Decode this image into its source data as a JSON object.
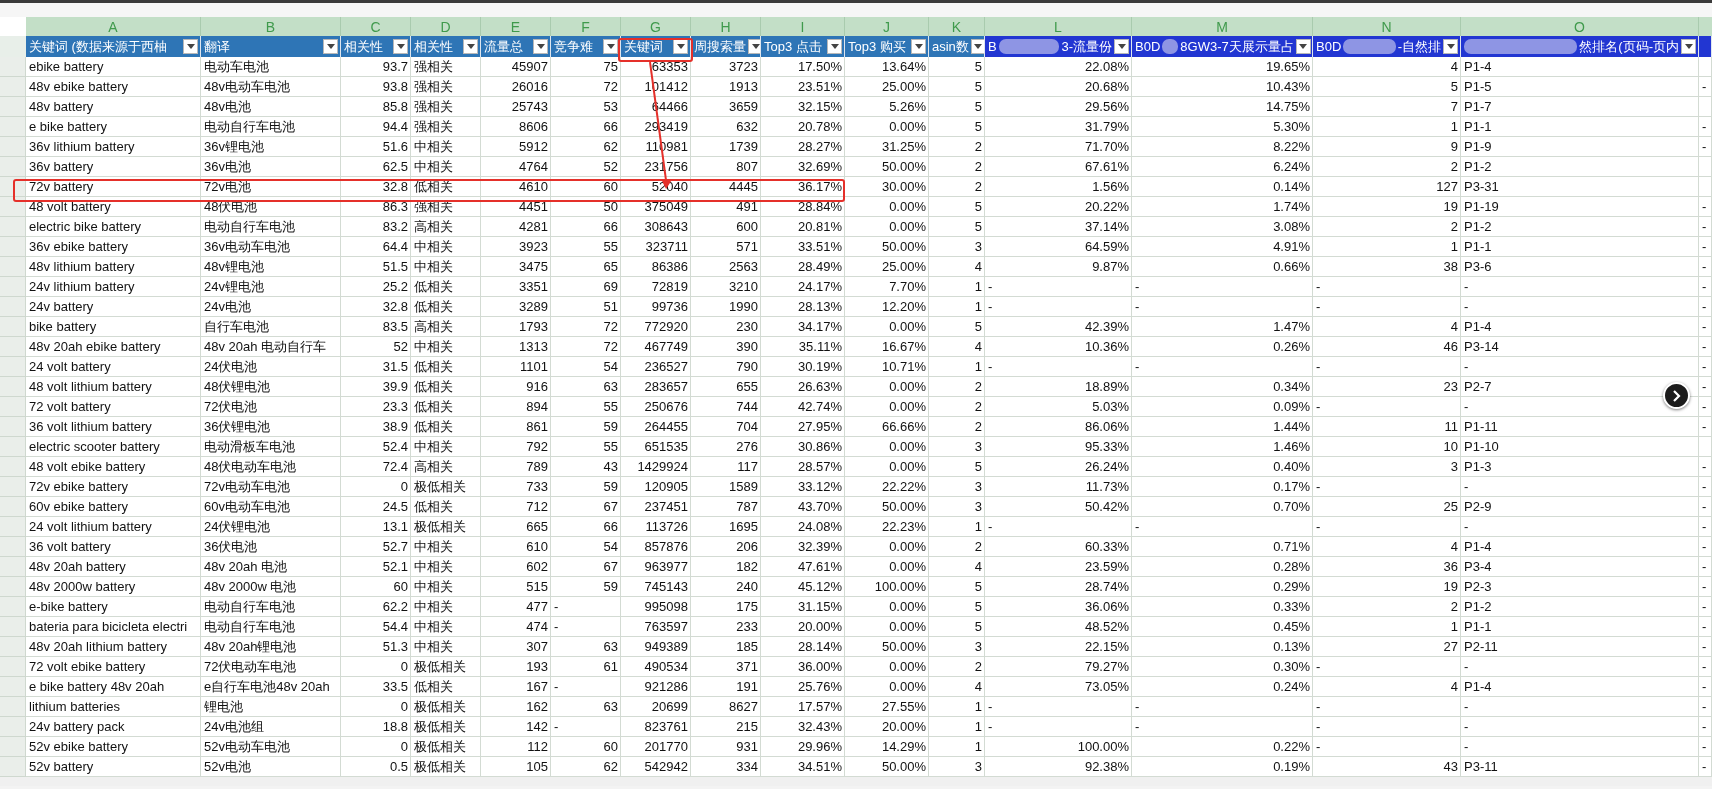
{
  "column_letters": [
    "A",
    "B",
    "C",
    "D",
    "E",
    "F",
    "G",
    "H",
    "I",
    "J",
    "K",
    "L",
    "M",
    "N",
    "O"
  ],
  "headers": [
    {
      "parts": [
        {
          "kind": "text",
          "text": "关键词 (数据来源于西柚"
        }
      ],
      "color": "#2e75b6",
      "filter": true
    },
    {
      "parts": [
        {
          "kind": "text",
          "text": "翻译"
        }
      ],
      "color": "#2e75b6",
      "filter": true
    },
    {
      "parts": [
        {
          "kind": "text",
          "text": "相关性"
        }
      ],
      "color": "#2e75b6",
      "filter": true
    },
    {
      "parts": [
        {
          "kind": "text",
          "text": "相关性"
        }
      ],
      "color": "#2e75b6",
      "filter": true
    },
    {
      "parts": [
        {
          "kind": "text",
          "text": "流量总"
        }
      ],
      "color": "#2e75b6",
      "filter": true
    },
    {
      "parts": [
        {
          "kind": "text",
          "text": "竞争难"
        }
      ],
      "color": "#2e75b6",
      "filter": true
    },
    {
      "parts": [
        {
          "kind": "text",
          "text": "关键词"
        }
      ],
      "color": "#2e75b6",
      "filter": true
    },
    {
      "parts": [
        {
          "kind": "text",
          "text": "周搜索量"
        }
      ],
      "color": "#2e75b6",
      "filter": true
    },
    {
      "parts": [
        {
          "kind": "text",
          "text": "Top3 点击"
        }
      ],
      "color": "#2e75b6",
      "filter": true
    },
    {
      "parts": [
        {
          "kind": "text",
          "text": "Top3 购买"
        }
      ],
      "color": "#2e75b6",
      "filter": true
    },
    {
      "parts": [
        {
          "kind": "text",
          "text": "asin数"
        }
      ],
      "color": "#2e75b6",
      "filter": true
    },
    {
      "parts": [
        {
          "kind": "text",
          "text": "B"
        },
        {
          "kind": "redacted"
        },
        {
          "kind": "text",
          "text": "3-流量份"
        }
      ],
      "color": "#2236d2",
      "filter": true
    },
    {
      "parts": [
        {
          "kind": "text",
          "text": "B0D"
        },
        {
          "kind": "redacted"
        },
        {
          "kind": "text",
          "text": "8GW3-7天展示量占"
        }
      ],
      "color": "#2236d2",
      "filter": true
    },
    {
      "parts": [
        {
          "kind": "text",
          "text": "B0D"
        },
        {
          "kind": "redacted"
        },
        {
          "kind": "text",
          "text": "-自然排"
        }
      ],
      "color": "#2236d2",
      "filter": true
    },
    {
      "parts": [
        {
          "kind": "redacted"
        },
        {
          "kind": "text",
          "text": "然排名(页码-页内"
        }
      ],
      "color": "#2236d2",
      "filter": true
    },
    {
      "color": "#2236d2"
    }
  ],
  "rows": [
    [
      "ebike battery",
      "电动车电池",
      "93.7",
      "强相关",
      "45907",
      "75",
      "63353",
      "3723",
      "17.50%",
      "13.64%",
      "5",
      "22.08%",
      "19.65%",
      "4",
      "P1-4",
      null
    ],
    [
      "48v ebike battery",
      "48v电动车电池",
      "93.8",
      "强相关",
      "26016",
      "72",
      "101412",
      "1913",
      "23.51%",
      "25.00%",
      "5",
      "20.68%",
      "10.43%",
      "5",
      "P1-5",
      {
        "kind": "blank",
        "text": "-"
      }
    ],
    [
      "48v battery",
      "48v电池",
      "85.8",
      "强相关",
      "25743",
      "53",
      "64466",
      "3659",
      "32.15%",
      "5.26%",
      "5",
      "29.56%",
      "14.75%",
      "7",
      "P1-7",
      null
    ],
    [
      "e bike battery",
      "电动自行车电池",
      "94.4",
      "强相关",
      "8606",
      "66",
      "293419",
      "632",
      "20.78%",
      "0.00%",
      "5",
      "31.79%",
      "5.30%",
      "1",
      "P1-1",
      {
        "kind": "blank",
        "text": "-"
      }
    ],
    [
      "36v lithium battery",
      "36v锂电池",
      "51.6",
      "中相关",
      "5912",
      "62",
      "110981",
      "1739",
      "28.27%",
      "31.25%",
      "2",
      "71.70%",
      "8.22%",
      "9",
      "P1-9",
      {
        "kind": "blank",
        "text": "-"
      }
    ],
    [
      "36v battery",
      "36v电池",
      "62.5",
      "中相关",
      "4764",
      "52",
      "231756",
      "807",
      "32.69%",
      "50.00%",
      "2",
      "67.61%",
      "6.24%",
      "2",
      "P1-2",
      null
    ],
    [
      "72v battery",
      "72v电池",
      "32.8",
      "低相关",
      "4610",
      "60",
      "52040",
      "4445",
      "36.17%",
      "30.00%",
      "2",
      "1.56%",
      "0.14%",
      "127",
      "P3-31",
      null
    ],
    [
      "48 volt battery",
      "48伏电池",
      "86.3",
      "强相关",
      "4451",
      "50",
      "375049",
      "491",
      "28.84%",
      "0.00%",
      "5",
      "20.22%",
      "1.74%",
      "19",
      "P1-19",
      {
        "kind": "blank",
        "text": "-"
      }
    ],
    [
      "electric bike battery",
      "电动自行车电池",
      "83.2",
      "高相关",
      "4281",
      "66",
      "308643",
      "600",
      "20.81%",
      "0.00%",
      "5",
      "37.14%",
      "3.08%",
      "2",
      "P1-2",
      {
        "kind": "blank",
        "text": "-"
      }
    ],
    [
      "36v ebike battery",
      "36v电动车电池",
      "64.4",
      "中相关",
      "3923",
      "55",
      "323711",
      "571",
      "33.51%",
      "50.00%",
      "3",
      "64.59%",
      "4.91%",
      "1",
      "P1-1",
      {
        "kind": "blank",
        "text": "-"
      }
    ],
    [
      "48v lithium battery",
      "48v锂电池",
      "51.5",
      "中相关",
      "3475",
      "65",
      "86386",
      "2563",
      "28.49%",
      "25.00%",
      "4",
      "9.87%",
      "0.66%",
      "38",
      "P3-6",
      {
        "kind": "blank",
        "text": "-"
      }
    ],
    [
      "24v lithium battery",
      "24v锂电池",
      "25.2",
      "低相关",
      "3351",
      "69",
      "72819",
      "3210",
      "24.17%",
      "7.70%",
      "1",
      {
        "kind": "blank",
        "text": "-"
      },
      {
        "kind": "blank",
        "text": "-"
      },
      {
        "kind": "blank",
        "text": "-"
      },
      {
        "kind": "blank",
        "text": "-"
      },
      {
        "kind": "blank",
        "text": "-"
      }
    ],
    [
      "24v battery",
      "24v电池",
      "32.8",
      "低相关",
      "3289",
      "51",
      "99736",
      "1990",
      "28.13%",
      "12.20%",
      "1",
      {
        "kind": "blank",
        "text": "-"
      },
      {
        "kind": "blank",
        "text": "-"
      },
      {
        "kind": "blank",
        "text": "-"
      },
      {
        "kind": "blank",
        "text": "-"
      },
      {
        "kind": "blank",
        "text": "-"
      }
    ],
    [
      "bike battery",
      "自行车电池",
      "83.5",
      "高相关",
      "1793",
      "72",
      "772920",
      "230",
      "34.17%",
      "0.00%",
      "5",
      "42.39%",
      "1.47%",
      "4",
      "P1-4",
      {
        "kind": "blank",
        "text": "-"
      }
    ],
    [
      "48v 20ah ebike battery",
      "48v 20ah 电动自行车",
      "52",
      "中相关",
      "1313",
      "72",
      "467749",
      "390",
      "35.11%",
      "16.67%",
      "4",
      "10.36%",
      "0.26%",
      "46",
      "P3-14",
      {
        "kind": "blank",
        "text": "-"
      }
    ],
    [
      "24 volt battery",
      "24伏电池",
      "31.5",
      "低相关",
      "1101",
      "54",
      "236527",
      "790",
      "30.19%",
      "10.71%",
      "1",
      {
        "kind": "blank",
        "text": "-"
      },
      {
        "kind": "blank",
        "text": "-"
      },
      {
        "kind": "blank",
        "text": "-"
      },
      {
        "kind": "blank",
        "text": "-"
      },
      {
        "kind": "blank",
        "text": "-"
      }
    ],
    [
      "48 volt lithium battery",
      "48伏锂电池",
      "39.9",
      "低相关",
      "916",
      "63",
      "283657",
      "655",
      "26.63%",
      "0.00%",
      "2",
      "18.89%",
      "0.34%",
      "23",
      "P2-7",
      {
        "kind": "blank",
        "text": "-"
      }
    ],
    [
      "72 volt battery",
      "72伏电池",
      "23.3",
      "低相关",
      "894",
      "55",
      "250676",
      "744",
      "42.74%",
      "0.00%",
      "2",
      "5.03%",
      "0.09%",
      {
        "kind": "blank",
        "text": "-"
      },
      {
        "kind": "blank",
        "text": "-"
      },
      {
        "kind": "blank",
        "text": "-"
      }
    ],
    [
      "36 volt lithium battery",
      "36伏锂电池",
      "38.9",
      "低相关",
      "861",
      "59",
      "264455",
      "704",
      "27.95%",
      "66.66%",
      "2",
      "86.06%",
      "1.44%",
      "11",
      "P1-11",
      {
        "kind": "blank",
        "text": "-"
      }
    ],
    [
      "electric scooter battery",
      "电动滑板车电池",
      "52.4",
      "中相关",
      "792",
      "55",
      "651535",
      "276",
      "30.86%",
      "0.00%",
      "3",
      "95.33%",
      "1.46%",
      "10",
      "P1-10",
      null
    ],
    [
      "48 volt ebike battery",
      "48伏电动车电池",
      "72.4",
      "高相关",
      "789",
      "43",
      "1429924",
      "117",
      "28.57%",
      "0.00%",
      "5",
      "26.24%",
      "0.40%",
      "3",
      "P1-3",
      {
        "kind": "blank",
        "text": "-"
      }
    ],
    [
      "72v ebike battery",
      "72v电动车电池",
      "0",
      "极低相关",
      "733",
      "59",
      "120905",
      "1589",
      "33.12%",
      "22.22%",
      "3",
      "11.73%",
      "0.17%",
      {
        "kind": "blank",
        "text": "-"
      },
      {
        "kind": "blank",
        "text": "-"
      },
      {
        "kind": "blank",
        "text": "-"
      }
    ],
    [
      "60v ebike battery",
      "60v电动车电池",
      "24.5",
      "低相关",
      "712",
      "67",
      "237451",
      "787",
      "43.70%",
      "50.00%",
      "3",
      "50.42%",
      "0.70%",
      "25",
      "P2-9",
      {
        "kind": "blank",
        "text": "-"
      }
    ],
    [
      "24 volt lithium battery",
      "24伏锂电池",
      "13.1",
      "极低相关",
      "665",
      "66",
      "113726",
      "1695",
      "24.08%",
      "22.23%",
      "1",
      {
        "kind": "blank",
        "text": "-"
      },
      {
        "kind": "blank",
        "text": "-"
      },
      {
        "kind": "blank",
        "text": "-"
      },
      {
        "kind": "blank",
        "text": "-"
      },
      {
        "kind": "blank",
        "text": "-"
      }
    ],
    [
      "36 volt battery",
      "36伏电池",
      "52.7",
      "中相关",
      "610",
      "54",
      "857876",
      "206",
      "32.39%",
      "0.00%",
      "2",
      "60.33%",
      "0.71%",
      "4",
      "P1-4",
      {
        "kind": "blank",
        "text": "-"
      }
    ],
    [
      "48v 20ah battery",
      "48v 20ah 电池",
      "52.1",
      "中相关",
      "602",
      "67",
      "963977",
      "182",
      "47.61%",
      "0.00%",
      "4",
      "23.59%",
      "0.28%",
      "36",
      "P3-4",
      {
        "kind": "blank",
        "text": "-"
      }
    ],
    [
      "48v 2000w battery",
      "48v 2000w 电池",
      "60",
      "中相关",
      "515",
      "59",
      "745143",
      "240",
      "45.12%",
      "100.00%",
      "5",
      "28.74%",
      "0.29%",
      "19",
      "P2-3",
      {
        "kind": "blank",
        "text": "-"
      }
    ],
    [
      "e-bike battery",
      "电动自行车电池",
      "62.2",
      "中相关",
      "477",
      {
        "kind": "blank",
        "text": "-"
      },
      "995098",
      "175",
      "31.15%",
      "0.00%",
      "5",
      "36.06%",
      "0.33%",
      "2",
      "P1-2",
      {
        "kind": "blank",
        "text": "-"
      }
    ],
    [
      "bateria para bicicleta electri",
      "电动自行车电池",
      "54.4",
      "中相关",
      "474",
      {
        "kind": "blank",
        "text": "-"
      },
      "763597",
      "233",
      "20.00%",
      "0.00%",
      "5",
      "48.52%",
      "0.45%",
      "1",
      "P1-1",
      {
        "kind": "blank",
        "text": "-"
      }
    ],
    [
      "48v 20ah lithium battery",
      "48v 20ah锂电池",
      "51.3",
      "中相关",
      "307",
      "63",
      "949389",
      "185",
      "28.14%",
      "50.00%",
      "3",
      "22.15%",
      "0.13%",
      "27",
      "P2-11",
      {
        "kind": "blank",
        "text": "-"
      }
    ],
    [
      "72 volt ebike battery",
      "72伏电动车电池",
      "0",
      "极低相关",
      "193",
      "61",
      "490534",
      "371",
      "36.00%",
      "0.00%",
      "2",
      "79.27%",
      "0.30%",
      {
        "kind": "blank",
        "text": "-"
      },
      {
        "kind": "blank",
        "text": "-"
      },
      {
        "kind": "blank",
        "text": "-"
      }
    ],
    [
      "e bike battery 48v 20ah",
      "e自行车电池48v 20ah",
      "33.5",
      "低相关",
      "167",
      {
        "kind": "blank",
        "text": "-"
      },
      "921286",
      "191",
      "25.76%",
      "0.00%",
      "4",
      "73.05%",
      "0.24%",
      "4",
      "P1-4",
      {
        "kind": "blank",
        "text": "-"
      }
    ],
    [
      "lithium batteries",
      "锂电池",
      "0",
      "极低相关",
      "162",
      "63",
      "20699",
      "8627",
      "17.57%",
      "27.55%",
      "1",
      {
        "kind": "blank",
        "text": "-"
      },
      {
        "kind": "blank",
        "text": "-"
      },
      {
        "kind": "blank",
        "text": "-"
      },
      {
        "kind": "blank",
        "text": "-"
      },
      {
        "kind": "blank",
        "text": "-"
      }
    ],
    [
      "24v battery pack",
      "24v电池组",
      "18.8",
      "极低相关",
      "142",
      {
        "kind": "blank",
        "text": "-"
      },
      "823761",
      "215",
      "32.43%",
      "20.00%",
      "1",
      {
        "kind": "blank",
        "text": "-"
      },
      {
        "kind": "blank",
        "text": "-"
      },
      {
        "kind": "blank",
        "text": "-"
      },
      {
        "kind": "blank",
        "text": "-"
      },
      {
        "kind": "blank",
        "text": "-"
      }
    ],
    [
      "52v ebike battery",
      "52v电动车电池",
      "0",
      "极低相关",
      "112",
      "60",
      "201770",
      "931",
      "29.96%",
      "14.29%",
      "1",
      "100.00%",
      "0.22%",
      {
        "kind": "blank",
        "text": "-"
      },
      {
        "kind": "blank",
        "text": "-"
      },
      {
        "kind": "blank",
        "text": "-"
      }
    ],
    [
      "52v battery",
      "52v电池",
      "0.5",
      "极低相关",
      "105",
      "62",
      "542942",
      "334",
      "34.51%",
      "50.00%",
      "3",
      "92.38%",
      "0.19%",
      "43",
      "P3-11",
      {
        "kind": "blank",
        "text": "-"
      }
    ]
  ]
}
